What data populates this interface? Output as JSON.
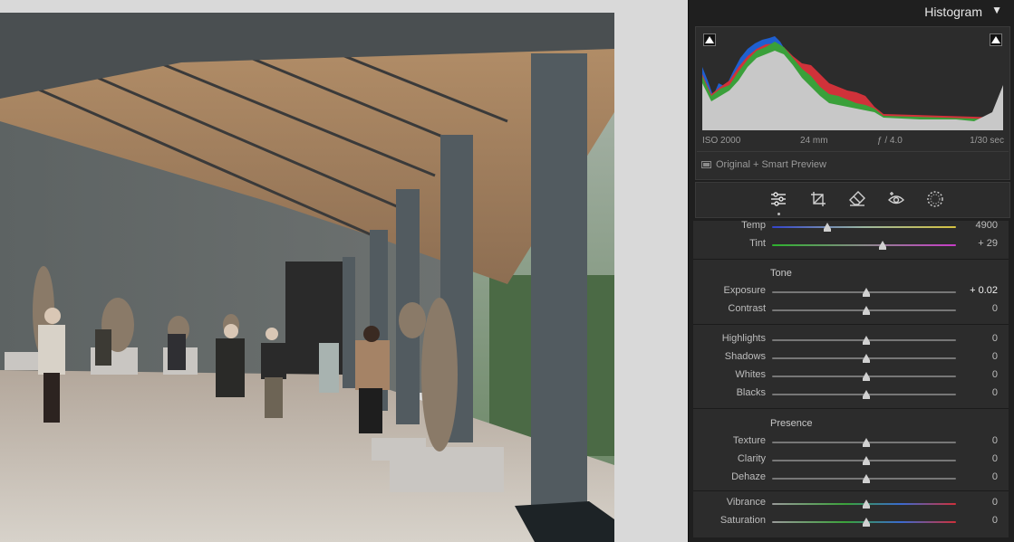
{
  "histogram": {
    "title": "Histogram",
    "caret": "▼",
    "exif": {
      "iso": "ISO 2000",
      "focal": "24 mm",
      "aperture": "ƒ / 4.0",
      "shutter": "1/30 sec"
    },
    "preview_label": "Original + Smart Preview"
  },
  "tools": [
    {
      "name": "edit-sliders-icon"
    },
    {
      "name": "crop-icon"
    },
    {
      "name": "healing-eraser-icon"
    },
    {
      "name": "red-eye-icon"
    },
    {
      "name": "masking-icon"
    }
  ],
  "sections": {
    "tone": "Tone",
    "presence": "Presence"
  },
  "sliders": [
    {
      "id": "temp",
      "label": "Temp",
      "value": "4900",
      "position": 0.3
    },
    {
      "id": "tint",
      "label": "Tint",
      "value": "+ 29",
      "position": 0.6
    },
    {
      "id": "exposure",
      "label": "Exposure",
      "value": "+ 0.02",
      "position": 0.51
    },
    {
      "id": "contrast",
      "label": "Contrast",
      "value": "0",
      "position": 0.51
    },
    {
      "id": "highlights",
      "label": "Highlights",
      "value": "0",
      "position": 0.51
    },
    {
      "id": "shadows",
      "label": "Shadows",
      "value": "0",
      "position": 0.51
    },
    {
      "id": "whites",
      "label": "Whites",
      "value": "0",
      "position": 0.51
    },
    {
      "id": "blacks",
      "label": "Blacks",
      "value": "0",
      "position": 0.51
    },
    {
      "id": "texture",
      "label": "Texture",
      "value": "0",
      "position": 0.51
    },
    {
      "id": "clarity",
      "label": "Clarity",
      "value": "0",
      "position": 0.51
    },
    {
      "id": "dehaze",
      "label": "Dehaze",
      "value": "0",
      "position": 0.51
    },
    {
      "id": "vibrance",
      "label": "Vibrance",
      "value": "0",
      "position": 0.51
    },
    {
      "id": "saturation",
      "label": "Saturation",
      "value": "0",
      "position": 0.51
    }
  ],
  "colors": {
    "panel_bg": "#1f1f1f",
    "section_bg": "#2c2c2c",
    "hist_blue": "#1f5fd0",
    "hist_red": "#d0323a",
    "hist_green": "#3aa03a",
    "hist_gray": "#c8c8c8"
  }
}
